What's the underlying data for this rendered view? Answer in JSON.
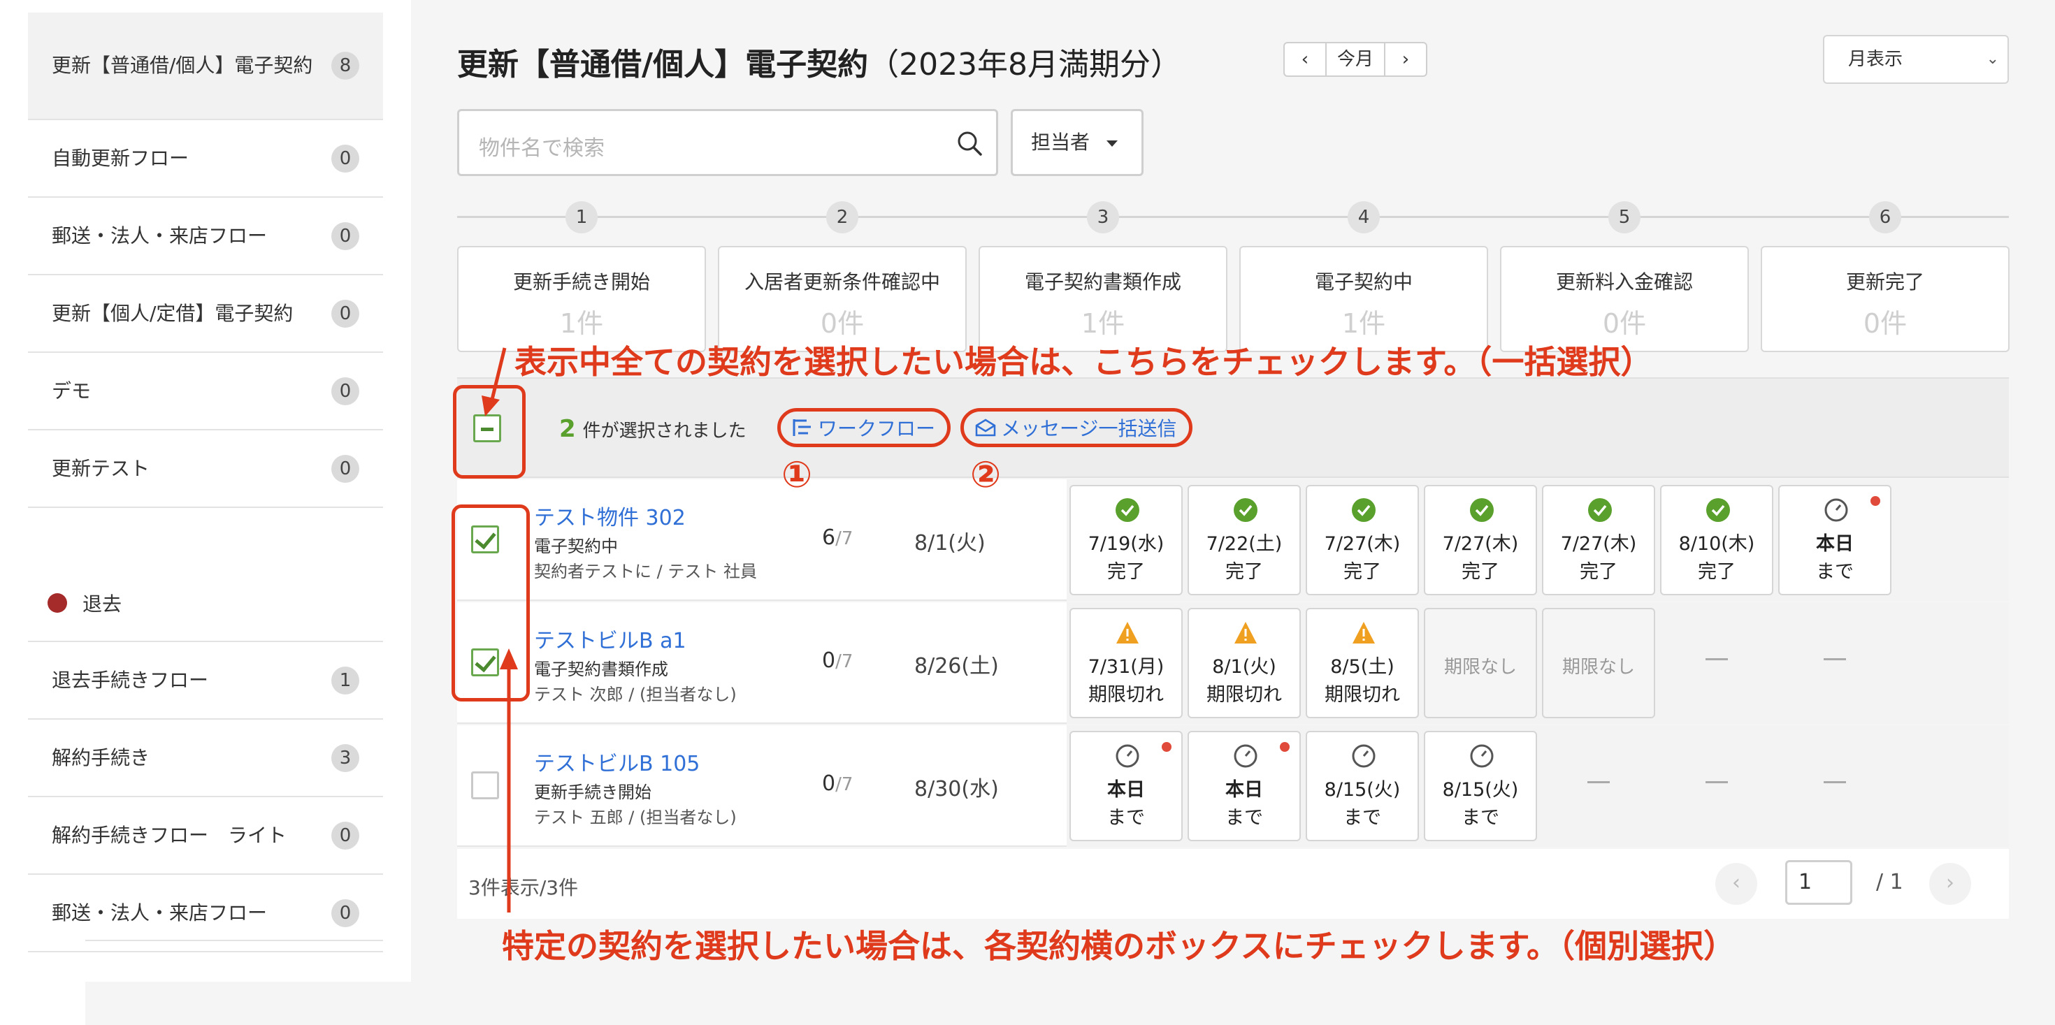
{
  "sidebar": {
    "items": [
      {
        "label": "更新【普通借/個人】電子契約",
        "count": "8"
      },
      {
        "label": "自動更新フロー",
        "count": "0"
      },
      {
        "label": "郵送・法人・来店フロー",
        "count": "0"
      },
      {
        "label": "更新【個人/定借】電子契約",
        "count": "0"
      },
      {
        "label": "デモ",
        "count": "0"
      },
      {
        "label": "更新テスト",
        "count": "0"
      }
    ],
    "section": {
      "label": "退去",
      "color": "#a52a2a"
    },
    "items2": [
      {
        "label": "退去手続きフロー",
        "count": "1"
      },
      {
        "label": "解約手続き",
        "count": "3"
      },
      {
        "label": "解約手続きフロー　ライト",
        "count": "0"
      },
      {
        "label": "郵送・法人・来店フロー",
        "count": "0"
      }
    ]
  },
  "header": {
    "title": "更新【普通借/個人】電子契約",
    "period": "（2023年8月満期分）",
    "prev": "‹",
    "today": "今月",
    "next": "›",
    "view": "月表示",
    "view_chevron": "⌄"
  },
  "search": {
    "placeholder": "物件名で検索"
  },
  "assignee": {
    "label": "担当者"
  },
  "steps": [
    {
      "num": "1",
      "label": "更新手続き開始",
      "count": "1件"
    },
    {
      "num": "2",
      "label": "入居者更新条件確認中",
      "count": "0件"
    },
    {
      "num": "3",
      "label": "電子契約書類作成",
      "count": "1件"
    },
    {
      "num": "4",
      "label": "電子契約中",
      "count": "1件"
    },
    {
      "num": "5",
      "label": "更新料入金確認",
      "count": "0件"
    },
    {
      "num": "6",
      "label": "更新完了",
      "count": "0件"
    }
  ],
  "selection": {
    "count": "2",
    "suffix": "件が選択されました",
    "workflow": "ワークフロー",
    "bulk_message": "メッセージ一括送信"
  },
  "rows": [
    {
      "name": "テスト物件  302",
      "status": "電子契約中",
      "person": "契約者テストに / テスト 社員",
      "progress": "6",
      "total": "/7",
      "due": "8/1(火)",
      "checked": true,
      "cells": [
        {
          "type": "done",
          "date": "7/19(水)",
          "note": "完了"
        },
        {
          "type": "done",
          "date": "7/22(土)",
          "note": "完了"
        },
        {
          "type": "done",
          "date": "7/27(木)",
          "note": "完了"
        },
        {
          "type": "done",
          "date": "7/27(木)",
          "note": "完了"
        },
        {
          "type": "done",
          "date": "7/27(木)",
          "note": "完了"
        },
        {
          "type": "done",
          "date": "8/10(木)",
          "note": "完了"
        },
        {
          "type": "due",
          "date": "本日",
          "note": "まで",
          "dot": true,
          "bold": true
        }
      ]
    },
    {
      "name": "テストビルB  a1",
      "status": "電子契約書類作成",
      "person": "テスト 次郎 / (担当者なし)",
      "progress": "0",
      "total": "/7",
      "due": "8/26(土)",
      "checked": true,
      "cells": [
        {
          "type": "warn",
          "date": "7/31(月)",
          "note": "期限切れ"
        },
        {
          "type": "warn",
          "date": "8/1(火)",
          "note": "期限切れ"
        },
        {
          "type": "warn",
          "date": "8/5(土)",
          "note": "期限切れ"
        },
        {
          "type": "none",
          "text": "期限なし"
        },
        {
          "type": "none",
          "text": "期限なし"
        },
        {
          "type": "dash"
        },
        {
          "type": "dash"
        }
      ]
    },
    {
      "name": "テストビルB  105",
      "status": "更新手続き開始",
      "person": "テスト 五郎 / (担当者なし)",
      "progress": "0",
      "total": "/7",
      "due": "8/30(水)",
      "checked": false,
      "cells": [
        {
          "type": "due",
          "date": "本日",
          "note": "まで",
          "dot": true,
          "bold": true
        },
        {
          "type": "due",
          "date": "本日",
          "note": "まで",
          "dot": true,
          "bold": true
        },
        {
          "type": "due",
          "date": "8/15(火)",
          "note": "まで"
        },
        {
          "type": "due",
          "date": "8/15(火)",
          "note": "まで"
        },
        {
          "type": "dash"
        },
        {
          "type": "dash"
        },
        {
          "type": "dash"
        }
      ]
    }
  ],
  "footer": {
    "count": "3件表示/3件",
    "page": "1",
    "total": "/ 1",
    "prev": "‹",
    "next": "›"
  },
  "annotations": {
    "bulk_text": "表示中全ての契約を選択したい場合は、こちらをチェックします。（一括選択）",
    "single_text": "特定の契約を選択したい場合は、各契約横のボックスにチェックします。（個別選択）",
    "num1": "①",
    "num2": "②"
  },
  "colors": {
    "accent": "#2f6fd6",
    "success": "#5aa02c",
    "warning": "#f0a020",
    "annotation": "#e03a1c",
    "dot": "#e04a3a"
  },
  "icons": {
    "search": "search-icon",
    "workflow": "workflow-icon",
    "mail": "mail-icon",
    "done": "check-circle-icon",
    "warn": "warning-icon",
    "due": "clock-icon"
  }
}
